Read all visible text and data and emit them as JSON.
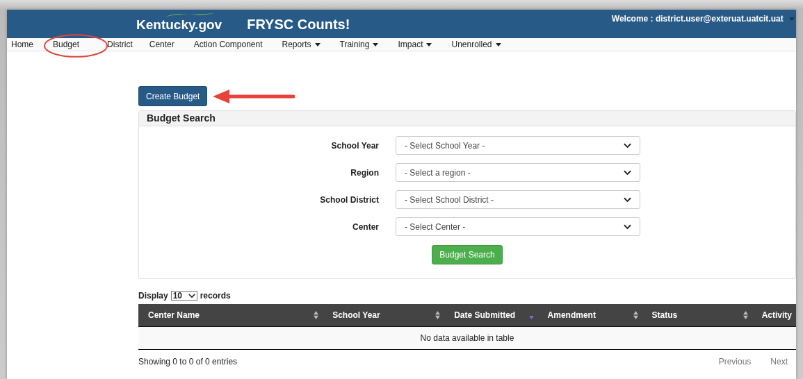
{
  "header": {
    "logo": "Kentucky.gov",
    "title": "FRYSC Counts!",
    "welcome": "Welcome : district.user@exteruat.uatcit.uat"
  },
  "nav": [
    {
      "label": "Home",
      "dropdown": false,
      "circled": false
    },
    {
      "label": "Budget",
      "dropdown": false,
      "circled": true
    },
    {
      "label": "District",
      "dropdown": false,
      "circled": false
    },
    {
      "label": "Center",
      "dropdown": false,
      "circled": false
    },
    {
      "label": "Action Component",
      "dropdown": false,
      "circled": false
    },
    {
      "label": "Reports",
      "dropdown": true,
      "circled": false
    },
    {
      "label": "Training",
      "dropdown": true,
      "circled": false
    },
    {
      "label": "Impact",
      "dropdown": true,
      "circled": false
    },
    {
      "label": "Unenrolled",
      "dropdown": true,
      "circled": false
    }
  ],
  "create_button": {
    "label": "Create Budget",
    "arrow": true
  },
  "search_panel": {
    "title": "Budget Search",
    "fields": [
      {
        "label": "School Year",
        "placeholder": "- Select School Year -"
      },
      {
        "label": "Region",
        "placeholder": "- Select a region -"
      },
      {
        "label": "School District",
        "placeholder": "- Select School District -"
      },
      {
        "label": "Center",
        "placeholder": "- Select Center -"
      }
    ],
    "button": "Budget Search"
  },
  "table": {
    "display_label": "Display",
    "page_size": "10",
    "records_label": "records",
    "columns": [
      {
        "label": "Center Name",
        "sortable": true,
        "sorted": false
      },
      {
        "label": "School Year",
        "sortable": true,
        "sorted": false
      },
      {
        "label": "Date Submitted",
        "sortable": true,
        "sorted": true
      },
      {
        "label": "Amendment",
        "sortable": true,
        "sorted": false
      },
      {
        "label": "Status",
        "sortable": true,
        "sorted": false
      },
      {
        "label": "Activity",
        "sortable": false
      }
    ],
    "empty": "No data available in table",
    "info": "Showing 0 to 0 of 0 entries",
    "previous": "Previous",
    "next": "Next"
  }
}
